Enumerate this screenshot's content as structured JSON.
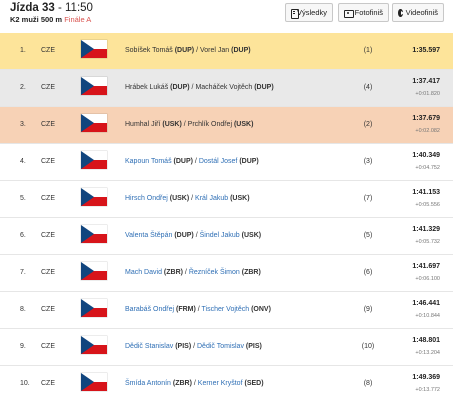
{
  "header": {
    "race_label": "Jízda",
    "race_number": "33",
    "time": "11:50",
    "category": "K2 muži 500 m",
    "phase": "Finále A"
  },
  "buttons": {
    "results": "Výsledky",
    "photo": "Fotofiniš",
    "video": "Videofiniš"
  },
  "colors": {
    "gold_row": "#fde49a",
    "silver_row": "#e9e9e9",
    "bronze_row": "#f7d2b6",
    "link": "#2f6fb5",
    "final_red": "#d9534f"
  },
  "results": [
    {
      "rank": "1.",
      "nation": "CZE",
      "flag": "czech-flag-icon",
      "athlete1": "Sobíšek Tomáš",
      "club1": "(DUP)",
      "athlete2": "Vorel Jan",
      "club2": "(DUP)",
      "lane": "(1)",
      "time": "1:35.597",
      "diff": ""
    },
    {
      "rank": "2.",
      "nation": "CZE",
      "flag": "czech-flag-icon",
      "athlete1": "Hrábek Lukáš",
      "club1": "(DUP)",
      "athlete2": "Macháček Vojtěch",
      "club2": "(DUP)",
      "lane": "(4)",
      "time": "1:37.417",
      "diff": "+0:01.820"
    },
    {
      "rank": "3.",
      "nation": "CZE",
      "flag": "czech-flag-icon",
      "athlete1": "Humhal Jiří",
      "club1": "(USK)",
      "athlete2": "Prchlík Ondřej",
      "club2": "(USK)",
      "lane": "(2)",
      "time": "1:37.679",
      "diff": "+0:02.082"
    },
    {
      "rank": "4.",
      "nation": "CZE",
      "flag": "czech-flag-icon",
      "athlete1": "Kapoun Tomáš",
      "club1": "(DUP)",
      "athlete2": "Dostál Josef",
      "club2": "(DUP)",
      "lane": "(3)",
      "time": "1:40.349",
      "diff": "+0:04.752"
    },
    {
      "rank": "5.",
      "nation": "CZE",
      "flag": "czech-flag-icon",
      "athlete1": "Hirsch Ondřej",
      "club1": "(USK)",
      "athlete2": "Král Jakub",
      "club2": "(USK)",
      "lane": "(7)",
      "time": "1:41.153",
      "diff": "+0:05.556"
    },
    {
      "rank": "6.",
      "nation": "CZE",
      "flag": "czech-flag-icon",
      "athlete1": "Valenta Štěpán",
      "club1": "(DUP)",
      "athlete2": "Šindel Jakub",
      "club2": "(USK)",
      "lane": "(5)",
      "time": "1:41.329",
      "diff": "+0:05.732"
    },
    {
      "rank": "7.",
      "nation": "CZE",
      "flag": "czech-flag-icon",
      "athlete1": "Mach David",
      "club1": "(ZBR)",
      "athlete2": "Řezníček Šimon",
      "club2": "(ZBR)",
      "lane": "(6)",
      "time": "1:41.697",
      "diff": "+0:06.100"
    },
    {
      "rank": "8.",
      "nation": "CZE",
      "flag": "czech-flag-icon",
      "athlete1": "Barabáš Ondřej",
      "club1": "(FRM)",
      "athlete2": "Tischer Vojtěch",
      "club2": "(ONV)",
      "lane": "(9)",
      "time": "1:46.441",
      "diff": "+0:10.844"
    },
    {
      "rank": "9.",
      "nation": "CZE",
      "flag": "czech-flag-icon",
      "athlete1": "Dědič Stanislav",
      "club1": "(PIS)",
      "athlete2": "Dědič Tomislav",
      "club2": "(PIS)",
      "lane": "(10)",
      "time": "1:48.801",
      "diff": "+0:13.204"
    },
    {
      "rank": "10.",
      "nation": "CZE",
      "flag": "czech-flag-icon",
      "athlete1": "Šmída Antonín",
      "club1": "(ZBR)",
      "athlete2": "Kerner Kryštof",
      "club2": "(SED)",
      "lane": "(8)",
      "time": "1:49.369",
      "diff": "+0:13.772"
    }
  ]
}
